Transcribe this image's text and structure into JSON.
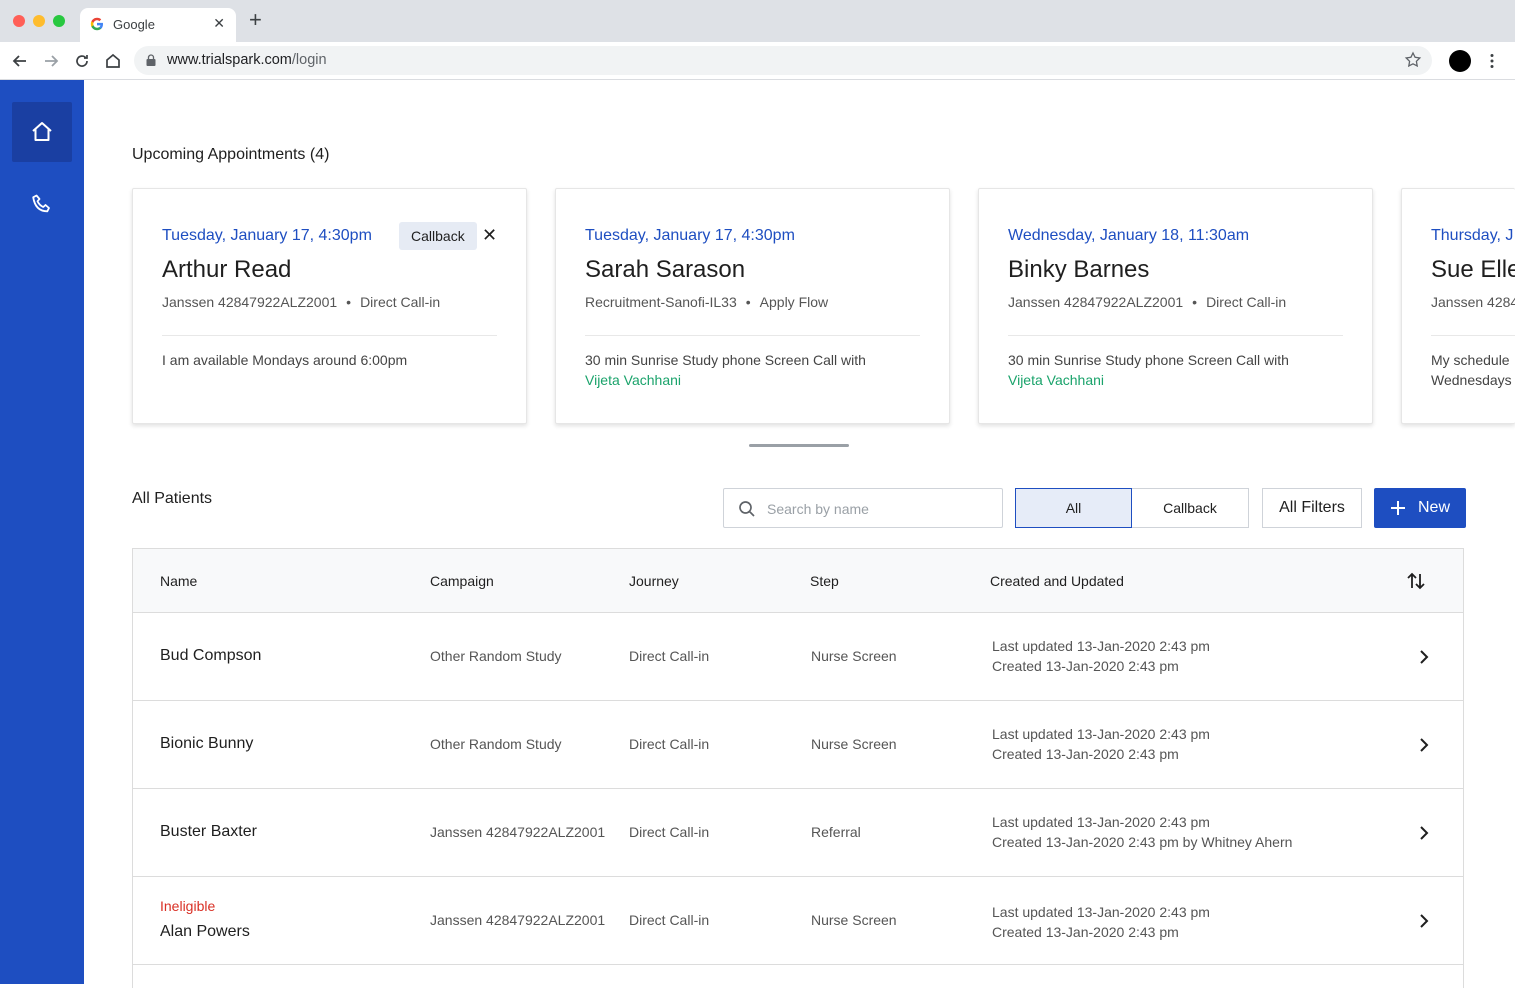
{
  "browser": {
    "tab_title": "Google",
    "url_host": "www.trialspark.com",
    "url_path": "/login"
  },
  "sidebar": {
    "items": [
      {
        "icon": "home-icon",
        "active": true
      },
      {
        "icon": "phone-icon",
        "active": false
      }
    ]
  },
  "appointments": {
    "title": "Upcoming Appointments (4)",
    "cards": [
      {
        "date": "Tuesday, January 17, 4:30pm",
        "name": "Arthur Read",
        "campaign": "Janssen 42847922ALZ2001",
        "journey": "Direct Call-in",
        "badge": "Callback",
        "note": "I am available Mondays around 6:00pm",
        "note_link": ""
      },
      {
        "date": "Tuesday, January 17, 4:30pm",
        "name": "Sarah Sarason",
        "campaign": "Recruitment-Sanofi-IL33",
        "journey": "Apply Flow",
        "note": "30 min Sunrise Study phone Screen Call with",
        "note_link": "Vijeta Vachhani"
      },
      {
        "date": "Wednesday, January 18, 11:30am",
        "name": "Binky Barnes",
        "campaign": "Janssen 42847922ALZ2001",
        "journey": "Direct Call-in",
        "note": "30 min Sunrise Study phone Screen Call with",
        "note_link": "Vijeta Vachhani"
      },
      {
        "date": "Thursday, J",
        "name": "Sue Elle",
        "campaign": "Janssen 4284",
        "note": "My schedule",
        "note_line2": "Wednesdays"
      }
    ]
  },
  "patients": {
    "title": "All Patients",
    "search_placeholder": "Search by name",
    "filter_all": "All",
    "filter_callback": "Callback",
    "all_filters": "All Filters",
    "new_label": "New",
    "columns": [
      "Name",
      "Campaign",
      "Journey",
      "Step",
      "Created and Updated"
    ],
    "rows": [
      {
        "status": "",
        "name": "Bud Compson",
        "campaign": "Other Random Study",
        "journey": "Direct Call-in",
        "step": "Nurse Screen",
        "updated": "Last updated 13-Jan-2020 2:43 pm",
        "created": "Created 13-Jan-2020 2:43 pm"
      },
      {
        "status": "",
        "name": "Bionic Bunny",
        "campaign": "Other Random Study",
        "journey": "Direct Call-in",
        "step": "Nurse Screen",
        "updated": "Last updated 13-Jan-2020 2:43 pm",
        "created": "Created 13-Jan-2020 2:43 pm"
      },
      {
        "status": "",
        "name": "Buster Baxter",
        "campaign": "Janssen 42847922ALZ2001",
        "journey": "Direct Call-in",
        "step": "Referral",
        "updated": "Last updated 13-Jan-2020 2:43 pm",
        "created": "Created 13-Jan-2020 2:43 pm by Whitney Ahern"
      },
      {
        "status": "Ineligible",
        "name": "Alan Powers",
        "campaign": "Janssen 42847922ALZ2001",
        "journey": "Direct Call-in",
        "step": "Nurse Screen",
        "updated": "Last updated 13-Jan-2020 2:43 pm",
        "created": "Created 13-Jan-2020 2:43 pm"
      }
    ]
  },
  "colors": {
    "brand_blue": "#1e4ec1",
    "link_green": "#1aa36b",
    "status_red": "#d93025"
  }
}
